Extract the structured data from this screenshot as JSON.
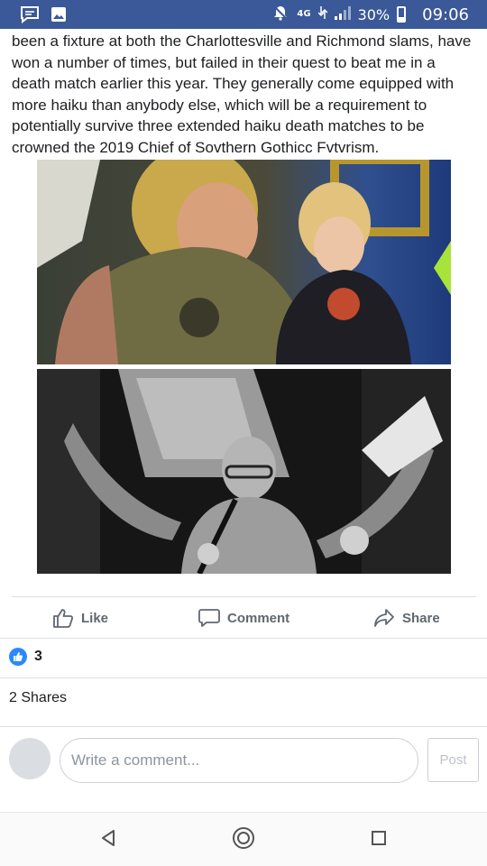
{
  "status_bar": {
    "network": "4G",
    "battery": "30%",
    "time": "09:06",
    "icons": [
      "messenger-icon",
      "gallery-icon",
      "alarm-mute-icon",
      "data-arrows-icon",
      "signal-icon",
      "battery-icon"
    ]
  },
  "post": {
    "text": "been a fixture at both the Charlottesville and Richmond slams, have won a number of times, but failed in their quest to beat me in a death match earlier this year. They generally come equipped with more haiku than anybody else, which will be a requirement to potentially survive three extended haiku death matches to be crowned the 2019 Chief of Sovthern Gothicc Fvtvrism."
  },
  "actions": {
    "like": "Like",
    "comment": "Comment",
    "share": "Share"
  },
  "reactions": {
    "count": "3"
  },
  "shares": {
    "label": "2 Shares"
  },
  "composer": {
    "placeholder": "Write a comment...",
    "post_label": "Post"
  },
  "colors": {
    "status_bar": "#3b5998",
    "like_blue": "#2d88ff",
    "action_gray": "#606770"
  }
}
